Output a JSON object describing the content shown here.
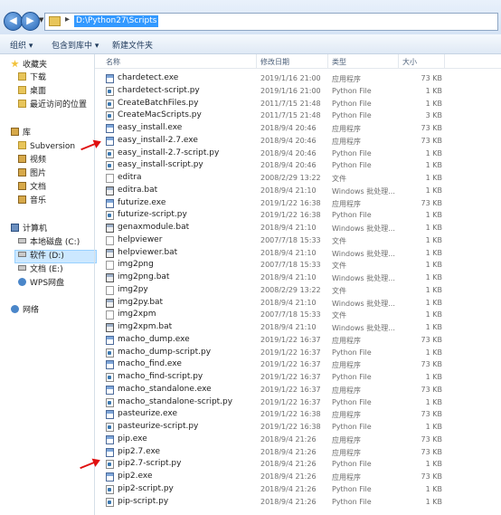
{
  "address_bar": {
    "path": "D:\\Python27\\Scripts",
    "back_glyph": "◀",
    "forward_glyph": "▶",
    "dropdown_glyph": "▼",
    "separator_glyph": "▸"
  },
  "toolbar": {
    "organize": "组织 ▾",
    "include_in_library": "包含到库中 ▾",
    "new_folder": "新建文件夹"
  },
  "nav": {
    "favorites": "收藏夹",
    "downloads": "下载",
    "desktop": "桌面",
    "recent": "最近访问的位置",
    "libraries": "库",
    "subversion": "Subversion",
    "videos": "视频",
    "pictures": "图片",
    "documents": "文档",
    "music": "音乐",
    "computer": "计算机",
    "drive_c": "本地磁盘 (C:)",
    "drive_d": "软件 (D:)",
    "drive_e": "文档 (E:)",
    "wps": "WPS网盘",
    "network": "网络"
  },
  "columns": {
    "name": "名称",
    "date": "修改日期",
    "type": "类型",
    "size": "大小"
  },
  "files": [
    {
      "name": "chardetect.exe",
      "date": "2019/1/16 21:00",
      "type": "应用程序",
      "size": "73 KB",
      "icon": "exe"
    },
    {
      "name": "chardetect-script.py",
      "date": "2019/1/16 21:00",
      "type": "Python File",
      "size": "1 KB",
      "icon": "py"
    },
    {
      "name": "CreateBatchFiles.py",
      "date": "2011/7/15 21:48",
      "type": "Python File",
      "size": "1 KB",
      "icon": "py"
    },
    {
      "name": "CreateMacScripts.py",
      "date": "2011/7/15 21:48",
      "type": "Python File",
      "size": "3 KB",
      "icon": "py"
    },
    {
      "name": "easy_install.exe",
      "date": "2018/9/4 20:46",
      "type": "应用程序",
      "size": "73 KB",
      "icon": "exe"
    },
    {
      "name": "easy_install-2.7.exe",
      "date": "2018/9/4 20:46",
      "type": "应用程序",
      "size": "73 KB",
      "icon": "exe"
    },
    {
      "name": "easy_install-2.7-script.py",
      "date": "2018/9/4 20:46",
      "type": "Python File",
      "size": "1 KB",
      "icon": "py"
    },
    {
      "name": "easy_install-script.py",
      "date": "2018/9/4 20:46",
      "type": "Python File",
      "size": "1 KB",
      "icon": "py"
    },
    {
      "name": "editra",
      "date": "2008/2/29 13:22",
      "type": "文件",
      "size": "1 KB",
      "icon": "file"
    },
    {
      "name": "editra.bat",
      "date": "2018/9/4 21:10",
      "type": "Windows 批处理...",
      "size": "1 KB",
      "icon": "bat"
    },
    {
      "name": "futurize.exe",
      "date": "2019/1/22 16:38",
      "type": "应用程序",
      "size": "73 KB",
      "icon": "exe"
    },
    {
      "name": "futurize-script.py",
      "date": "2019/1/22 16:38",
      "type": "Python File",
      "size": "1 KB",
      "icon": "py"
    },
    {
      "name": "genaxmodule.bat",
      "date": "2018/9/4 21:10",
      "type": "Windows 批处理...",
      "size": "1 KB",
      "icon": "bat"
    },
    {
      "name": "helpviewer",
      "date": "2007/7/18 15:33",
      "type": "文件",
      "size": "1 KB",
      "icon": "file"
    },
    {
      "name": "helpviewer.bat",
      "date": "2018/9/4 21:10",
      "type": "Windows 批处理...",
      "size": "1 KB",
      "icon": "bat"
    },
    {
      "name": "img2png",
      "date": "2007/7/18 15:33",
      "type": "文件",
      "size": "1 KB",
      "icon": "file"
    },
    {
      "name": "img2png.bat",
      "date": "2018/9/4 21:10",
      "type": "Windows 批处理...",
      "size": "1 KB",
      "icon": "bat"
    },
    {
      "name": "img2py",
      "date": "2008/2/29 13:22",
      "type": "文件",
      "size": "1 KB",
      "icon": "file"
    },
    {
      "name": "img2py.bat",
      "date": "2018/9/4 21:10",
      "type": "Windows 批处理...",
      "size": "1 KB",
      "icon": "bat"
    },
    {
      "name": "img2xpm",
      "date": "2007/7/18 15:33",
      "type": "文件",
      "size": "1 KB",
      "icon": "file"
    },
    {
      "name": "img2xpm.bat",
      "date": "2018/9/4 21:10",
      "type": "Windows 批处理...",
      "size": "1 KB",
      "icon": "bat"
    },
    {
      "name": "macho_dump.exe",
      "date": "2019/1/22 16:37",
      "type": "应用程序",
      "size": "73 KB",
      "icon": "exe"
    },
    {
      "name": "macho_dump-script.py",
      "date": "2019/1/22 16:37",
      "type": "Python File",
      "size": "1 KB",
      "icon": "py"
    },
    {
      "name": "macho_find.exe",
      "date": "2019/1/22 16:37",
      "type": "应用程序",
      "size": "73 KB",
      "icon": "exe"
    },
    {
      "name": "macho_find-script.py",
      "date": "2019/1/22 16:37",
      "type": "Python File",
      "size": "1 KB",
      "icon": "py"
    },
    {
      "name": "macho_standalone.exe",
      "date": "2019/1/22 16:37",
      "type": "应用程序",
      "size": "73 KB",
      "icon": "exe"
    },
    {
      "name": "macho_standalone-script.py",
      "date": "2019/1/22 16:37",
      "type": "Python File",
      "size": "1 KB",
      "icon": "py"
    },
    {
      "name": "pasteurize.exe",
      "date": "2019/1/22 16:38",
      "type": "应用程序",
      "size": "73 KB",
      "icon": "exe"
    },
    {
      "name": "pasteurize-script.py",
      "date": "2019/1/22 16:38",
      "type": "Python File",
      "size": "1 KB",
      "icon": "py"
    },
    {
      "name": "pip.exe",
      "date": "2018/9/4 21:26",
      "type": "应用程序",
      "size": "73 KB",
      "icon": "exe"
    },
    {
      "name": "pip2.7.exe",
      "date": "2018/9/4 21:26",
      "type": "应用程序",
      "size": "73 KB",
      "icon": "exe"
    },
    {
      "name": "pip2.7-script.py",
      "date": "2018/9/4 21:26",
      "type": "Python File",
      "size": "1 KB",
      "icon": "py"
    },
    {
      "name": "pip2.exe",
      "date": "2018/9/4 21:26",
      "type": "应用程序",
      "size": "73 KB",
      "icon": "exe"
    },
    {
      "name": "pip2-script.py",
      "date": "2018/9/4 21:26",
      "type": "Python File",
      "size": "1 KB",
      "icon": "py"
    },
    {
      "name": "pip-script.py",
      "date": "2018/9/4 21:26",
      "type": "Python File",
      "size": "1 KB",
      "icon": "py"
    }
  ],
  "colors": {
    "selection": "#3399ff",
    "annotation_arrow": "#e01010",
    "nav_selected": "#cce8ff"
  }
}
